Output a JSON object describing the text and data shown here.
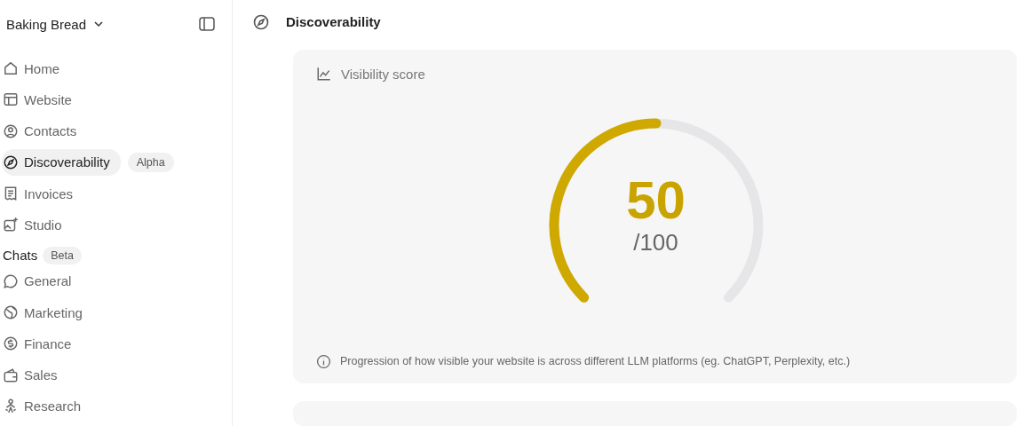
{
  "sidebar": {
    "workspace": "Baking Bread",
    "items": [
      {
        "label": "Home",
        "selected": false
      },
      {
        "label": "Website",
        "selected": false
      },
      {
        "label": "Contacts",
        "selected": false
      },
      {
        "label": "Discoverability",
        "selected": true,
        "badge": "Alpha"
      },
      {
        "label": "Invoices",
        "selected": false
      },
      {
        "label": "Studio",
        "selected": false
      }
    ],
    "chats": {
      "title": "Chats",
      "badge": "Beta",
      "items": [
        {
          "label": "General",
          "selected": false
        },
        {
          "label": "Marketing",
          "selected": false
        },
        {
          "label": "Finance",
          "selected": false
        },
        {
          "label": "Sales",
          "selected": false
        },
        {
          "label": "Research",
          "selected": false
        }
      ]
    }
  },
  "header": {
    "title": "Discoverability"
  },
  "card": {
    "title": "Visibility score",
    "score": "50",
    "max": "/100",
    "level": 0.5,
    "note": "Progression of how visible your website is across different LLM platforms (eg. ChatGPT, Perplexity, etc.)"
  }
}
